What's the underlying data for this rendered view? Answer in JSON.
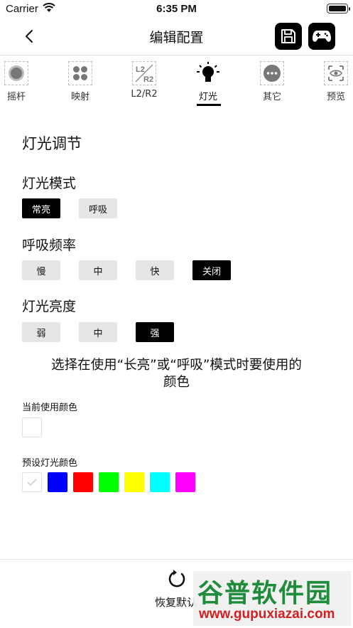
{
  "status_bar": {
    "carrier": "Carrier",
    "time": "6:35 PM"
  },
  "nav": {
    "title": "编辑配置"
  },
  "tabs": [
    {
      "label": "摇杆",
      "icon": "joystick-icon"
    },
    {
      "label": "映射",
      "icon": "mapping-icon"
    },
    {
      "label": "L2/R2",
      "icon": "trigger-icon",
      "icon_text_top": "L2",
      "icon_text_bottom": "R2"
    },
    {
      "label": "灯光",
      "icon": "light-bulb-icon",
      "active": true
    },
    {
      "label": "其它",
      "icon": "more-icon"
    },
    {
      "label": "预览",
      "icon": "preview-eye-icon"
    }
  ],
  "content": {
    "section_title": "灯光调节",
    "light_mode": {
      "label": "灯光模式",
      "options": [
        "常亮",
        "呼吸"
      ],
      "selected": "常亮"
    },
    "breath_freq": {
      "label": "呼吸频率",
      "options": [
        "慢",
        "中",
        "快",
        "关闭"
      ],
      "selected": "关闭"
    },
    "brightness": {
      "label": "灯光亮度",
      "options": [
        "弱",
        "中",
        "强"
      ],
      "selected": "强"
    },
    "hint_line1": "选择在使用“长亮”或“呼吸”模式时要使用的",
    "hint_line2": "颜色",
    "current_color_label": "当前使用颜色",
    "current_color": "#ffffff",
    "preset_label": "预设灯光颜色",
    "preset_colors": [
      "#ffffff",
      "#0000ff",
      "#ff0000",
      "#00ff00",
      "#ffff00",
      "#00ffff",
      "#ff00ff"
    ],
    "preset_selected": "#ffffff"
  },
  "bottom": {
    "reset_label": "恢复默认"
  },
  "watermark": {
    "text": "谷普软件园",
    "url": "www.gupuxiazai.com"
  }
}
